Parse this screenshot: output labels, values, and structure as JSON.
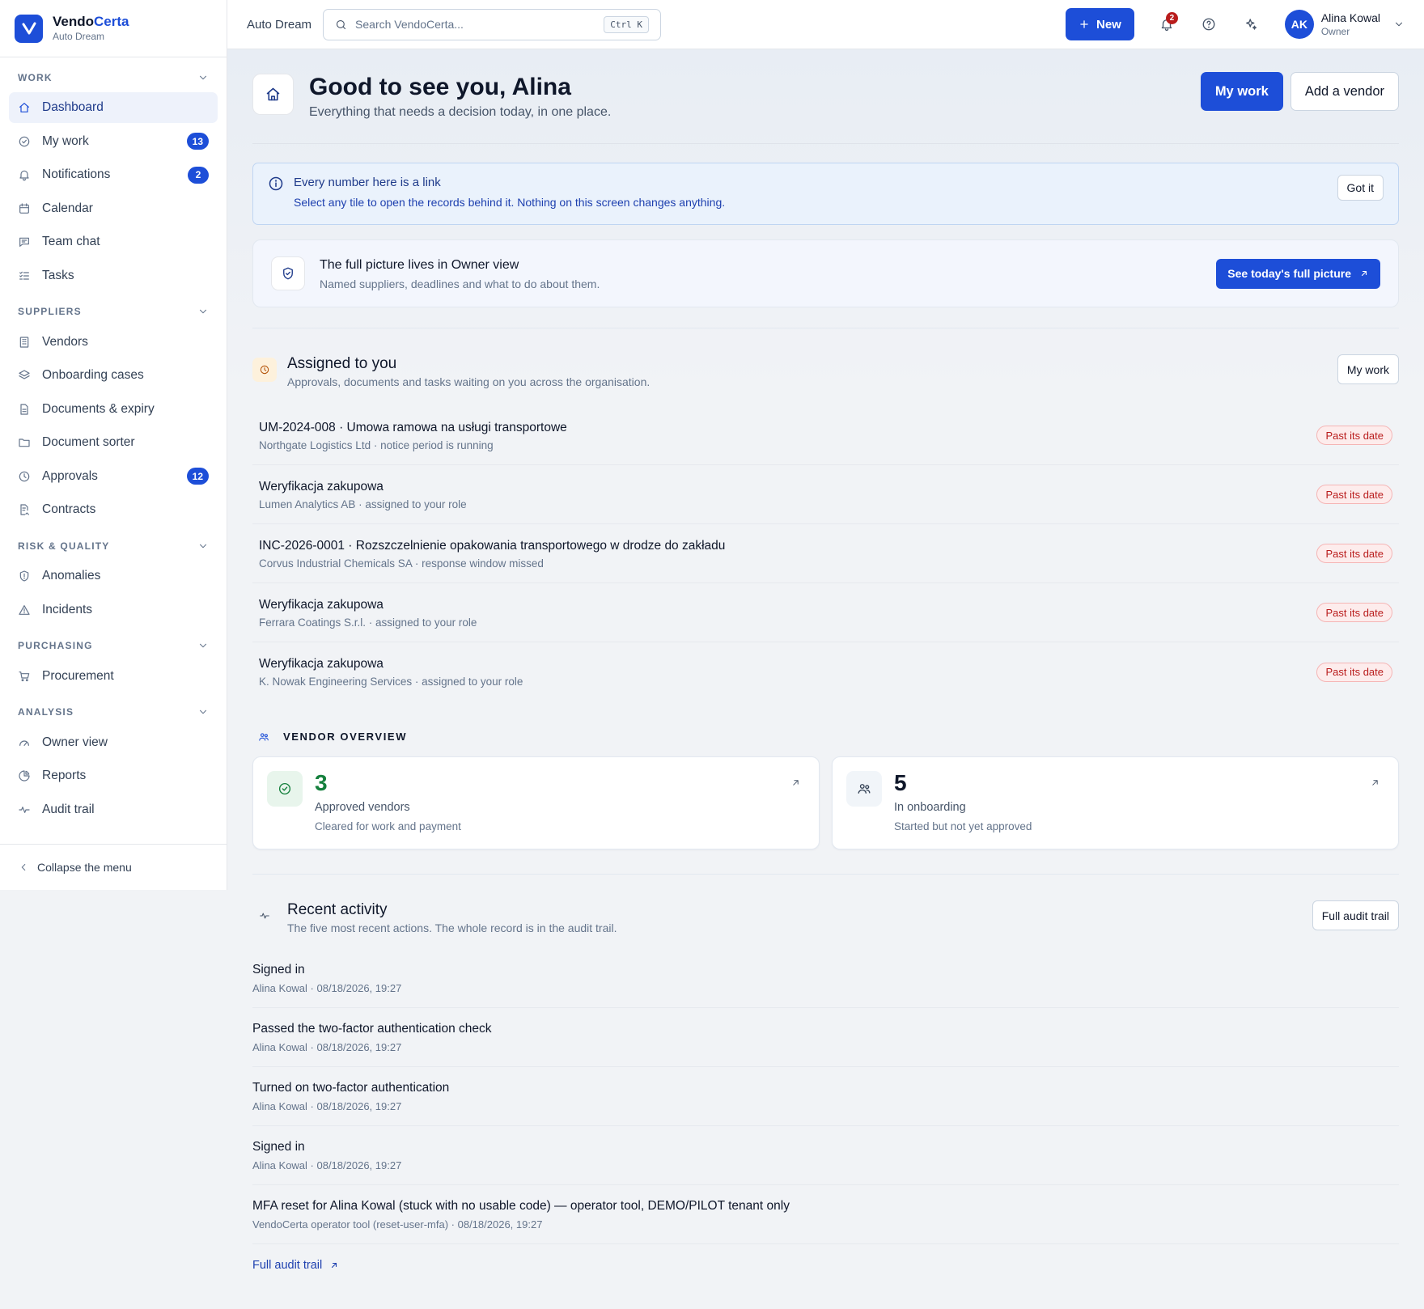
{
  "brand": {
    "name_part1": "Vendo",
    "name_part2": "Certa",
    "org": "Auto Dream"
  },
  "sidebar": {
    "sections": [
      {
        "title": "WORK",
        "items": [
          {
            "label": "Dashboard",
            "icon": "home-icon",
            "active": true
          },
          {
            "label": "My work",
            "icon": "check-circle-icon",
            "badge": "13"
          },
          {
            "label": "Notifications",
            "icon": "bell-icon",
            "badge": "2"
          },
          {
            "label": "Calendar",
            "icon": "calendar-icon"
          },
          {
            "label": "Team chat",
            "icon": "chat-icon"
          },
          {
            "label": "Tasks",
            "icon": "list-check-icon"
          }
        ]
      },
      {
        "title": "SUPPLIERS",
        "items": [
          {
            "label": "Vendors",
            "icon": "building-icon"
          },
          {
            "label": "Onboarding cases",
            "icon": "layers-icon"
          },
          {
            "label": "Documents & expiry",
            "icon": "file-icon"
          },
          {
            "label": "Document sorter",
            "icon": "folder-icon"
          },
          {
            "label": "Approvals",
            "icon": "clock-icon",
            "badge": "12"
          },
          {
            "label": "Contracts",
            "icon": "contract-icon"
          }
        ]
      },
      {
        "title": "RISK & QUALITY",
        "items": [
          {
            "label": "Anomalies",
            "icon": "shield-icon"
          },
          {
            "label": "Incidents",
            "icon": "warning-icon"
          }
        ]
      },
      {
        "title": "PURCHASING",
        "items": [
          {
            "label": "Procurement",
            "icon": "cart-icon"
          }
        ]
      },
      {
        "title": "ANALYSIS",
        "items": [
          {
            "label": "Owner view",
            "icon": "gauge-icon"
          },
          {
            "label": "Reports",
            "icon": "pie-icon"
          },
          {
            "label": "Audit trail",
            "icon": "activity-icon"
          }
        ]
      }
    ],
    "collapse_label": "Collapse the menu"
  },
  "topbar": {
    "org_name": "Auto Dream",
    "search_placeholder": "Search VendoCerta...",
    "search_shortcut": "Ctrl K",
    "new_label": "New",
    "notifications_count": "2",
    "user": {
      "initials": "AK",
      "name": "Alina Kowal",
      "role": "Owner"
    }
  },
  "hero": {
    "title": "Good to see you, Alina",
    "subtitle": "Everything that needs a decision today, in one place.",
    "primary_action": "My work",
    "secondary_action": "Add a vendor"
  },
  "info_banner": {
    "title": "Every number here is a link",
    "text": "Select any tile to open the records behind it. Nothing on this screen changes anything.",
    "dismiss_label": "Got it"
  },
  "owner_callout": {
    "title": "The full picture lives in Owner view",
    "subtitle": "Named suppliers, deadlines and what to do about them.",
    "action": "See today's full picture"
  },
  "assigned": {
    "title": "Assigned to you",
    "subtitle": "Approvals, documents and tasks waiting on you across the organisation.",
    "action": "My work",
    "rows": [
      {
        "title": "UM-2024-008 · Umowa ramowa na usługi transportowe",
        "subtitle": "Northgate Logistics Ltd · notice period is running",
        "status": "Past its date"
      },
      {
        "title": "Weryfikacja zakupowa",
        "subtitle": "Lumen Analytics AB · assigned to your role",
        "status": "Past its date"
      },
      {
        "title": "INC-2026-0001 · Rozszczelnienie opakowania transportowego w drodze do zakładu",
        "subtitle": "Corvus Industrial Chemicals SA · response window missed",
        "status": "Past its date"
      },
      {
        "title": "Weryfikacja zakupowa",
        "subtitle": "Ferrara Coatings S.r.l. · assigned to your role",
        "status": "Past its date"
      },
      {
        "title": "Weryfikacja zakupowa",
        "subtitle": "K. Nowak Engineering Services · assigned to your role",
        "status": "Past its date"
      }
    ]
  },
  "vendor_overview": {
    "label": "VENDOR OVERVIEW",
    "cards": [
      {
        "value": "3",
        "label": "Approved vendors",
        "subtitle": "Cleared for work and payment",
        "icon": "check-circle-icon",
        "color": "#15803d"
      },
      {
        "value": "5",
        "label": "In onboarding",
        "subtitle": "Started but not yet approved",
        "icon": "users-icon",
        "color": "#0f172a"
      }
    ]
  },
  "recent_activity": {
    "title": "Recent activity",
    "subtitle": "The five most recent actions. The whole record is in the audit trail.",
    "action": "Full audit trail",
    "items": [
      {
        "title": "Signed in",
        "subtitle": "Alina Kowal · 08/18/2026, 19:27"
      },
      {
        "title": "Passed the two-factor authentication check",
        "subtitle": "Alina Kowal · 08/18/2026, 19:27"
      },
      {
        "title": "Turned on two-factor authentication",
        "subtitle": "Alina Kowal · 08/18/2026, 19:27"
      },
      {
        "title": "Signed in",
        "subtitle": "Alina Kowal · 08/18/2026, 19:27"
      },
      {
        "title": "MFA reset for Alina Kowal (stuck with no usable code) — operator tool, DEMO/PILOT tenant only",
        "subtitle": "VendoCerta operator tool (reset-user-mfa) · 08/18/2026, 19:27"
      }
    ],
    "footer_link": "Full audit trail"
  },
  "colors": {
    "accent": "#1d4ed8",
    "danger": "#b91c1c",
    "success": "#15803d"
  }
}
